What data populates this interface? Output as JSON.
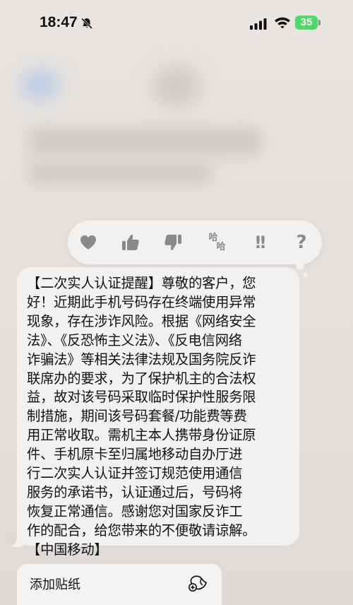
{
  "status_bar": {
    "time": "18:47",
    "battery": "35"
  },
  "tapback": {
    "icons": [
      "heart-icon",
      "thumbs-up-icon",
      "thumbs-down-icon",
      "haha-icon",
      "exclamation-icon",
      "question-icon"
    ],
    "haha_line1": "哈",
    "haha_line2": "哈",
    "exclamation": "!!",
    "question": "?"
  },
  "message": {
    "text": "【二次实人认证提醒】尊敬的客户，您\n好！近期此手机号码存在终端使用异常\n现象，存在涉诈风险。根据《网络安全\n法》、《反恐怖主义法》、《反电信网络\n诈骗法》等相关法律法规及国务院反诈\n联席办的要求，为了保护机主的合法权\n益，故对该号码采取临时保护性服务限\n制措施，期间该号码套餐/功能费等费\n用正常收取。需机主本人携带身份证原\n件、手机原卡至归属地移动自办厅进\n行二次实人认证并签订规范使用通信\n服务的承诺书，认证通过后，号码将\n恢复正常通信。感谢您对国家反诈工\n作的配合，给您带来的不便敬请谅解。\n【中国移动】"
  },
  "context_menu": {
    "items": [
      {
        "label": "添加贴纸",
        "icon": "sticker-icon"
      }
    ]
  },
  "colors": {
    "bubble": "#f2f1f0",
    "background": "#e4e0dd",
    "tapback_icon": "#8a8a8a",
    "battery": "#4cd964"
  }
}
